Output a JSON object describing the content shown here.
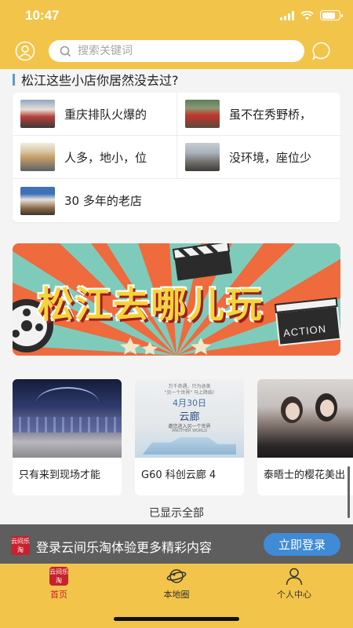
{
  "status": {
    "time": "10:47"
  },
  "search": {
    "placeholder": "搜索关键词"
  },
  "section": {
    "title": "松江这些小店你居然没去过?"
  },
  "shops": [
    {
      "name": "重庆排队火爆的"
    },
    {
      "name": "虽不在秀野桥，"
    },
    {
      "name": "人多，地小，位"
    },
    {
      "name": "没环境，座位少"
    },
    {
      "name": "30 多年的老店"
    }
  ],
  "banner": {
    "title": "松江去哪儿玩",
    "action": "ACTION"
  },
  "places": [
    {
      "name": "只有来到现场才能"
    },
    {
      "name": "G60 科创云廊 4"
    },
    {
      "name": "泰晤士的樱花美出"
    }
  ],
  "poster": {
    "line1": "万千奇遇，只为途美",
    "line2": "\"另一个世界\" 马上降临!",
    "date": "4月30日",
    "title": "云廊",
    "sub": "邀您进入另一个世界",
    "en": "ANOTHER WORLD"
  },
  "footer": {
    "note": "已显示全部"
  },
  "login": {
    "logo": "云间乐淘",
    "text": "登录云间乐淘体验更多精彩内容",
    "button": "立即登录"
  },
  "tabs": [
    {
      "label": "首页",
      "logo": "云间乐淘",
      "icon": "app-logo-icon",
      "active": true
    },
    {
      "label": "本地圈",
      "icon": "planet-icon",
      "active": false
    },
    {
      "label": "个人中心",
      "icon": "person-icon",
      "active": false
    }
  ],
  "colors": {
    "header": "#f2c54a",
    "accent": "#c8222c",
    "login_button": "#3f8bd6"
  }
}
